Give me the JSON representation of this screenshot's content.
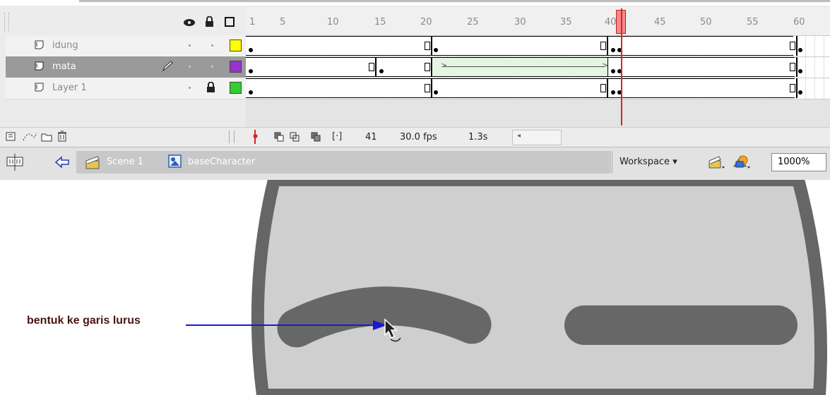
{
  "timeline": {
    "ruler": [
      "1",
      "5",
      "10",
      "15",
      "20",
      "25",
      "30",
      "35",
      "40",
      "45",
      "50",
      "55",
      "60"
    ],
    "layers": [
      {
        "name": "idung",
        "color": "#ffff00"
      },
      {
        "name": "mata",
        "color": "#9933cc"
      },
      {
        "name": "Layer 1",
        "color": "#33cc33"
      }
    ],
    "footer": {
      "frame": "41",
      "fps": "30.0 fps",
      "time": "1.3s"
    }
  },
  "scenebar": {
    "scene": "Scene 1",
    "symbol": "baseCharacter",
    "workspace": "Workspace ▾",
    "zoom": "1000%"
  },
  "stage": {
    "annotation": "bentuk ke garis lurus",
    "face_fill": "#cfcfcf",
    "face_outline": "#666666",
    "eye_color": "#676767",
    "arrow_color": "#1a1ad2"
  }
}
